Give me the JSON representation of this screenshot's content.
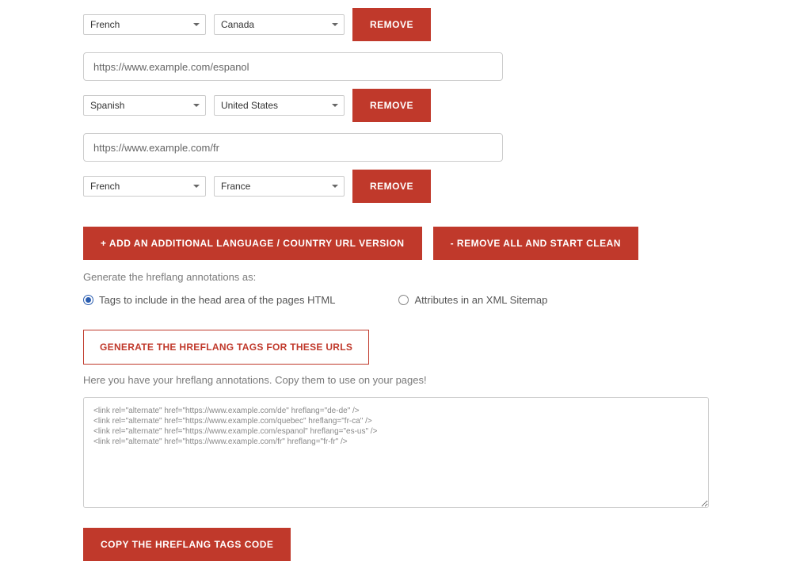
{
  "entries": [
    {
      "language": "French",
      "country": "Canada",
      "remove_label": "REMOVE",
      "url": "https://www.example.com/espanol",
      "show_url_above": false
    },
    {
      "language": "Spanish",
      "country": "United States",
      "remove_label": "REMOVE",
      "url": "https://www.example.com/fr",
      "show_url_above": true,
      "above_url": "https://www.example.com/espanol"
    },
    {
      "language": "French",
      "country": "France",
      "remove_label": "REMOVE",
      "url": "",
      "show_url_above": true,
      "above_url": "https://www.example.com/fr"
    }
  ],
  "buttons": {
    "add": "+ ADD AN ADDITIONAL LANGUAGE / COUNTRY URL VERSION",
    "remove_all": "- REMOVE ALL AND START CLEAN",
    "generate": "GENERATE THE HREFLANG TAGS FOR THESE URLS",
    "copy": "COPY THE HREFLANG TAGS CODE"
  },
  "labels": {
    "generate_as": "Generate the hreflang annotations as:",
    "radio_html": "Tags to include in the head area of the pages HTML",
    "radio_xml": "Attributes in an XML Sitemap",
    "output_help": "Here you have your hreflang annotations. Copy them to use on your pages!"
  },
  "output": "<link rel=\"alternate\" href=\"https://www.example.com/de\" hreflang=\"de-de\" />\n<link rel=\"alternate\" href=\"https://www.example.com/quebec\" hreflang=\"fr-ca\" />\n<link rel=\"alternate\" href=\"https://www.example.com/espanol\" hreflang=\"es-us\" />\n<link rel=\"alternate\" href=\"https://www.example.com/fr\" hreflang=\"fr-fr\" />"
}
